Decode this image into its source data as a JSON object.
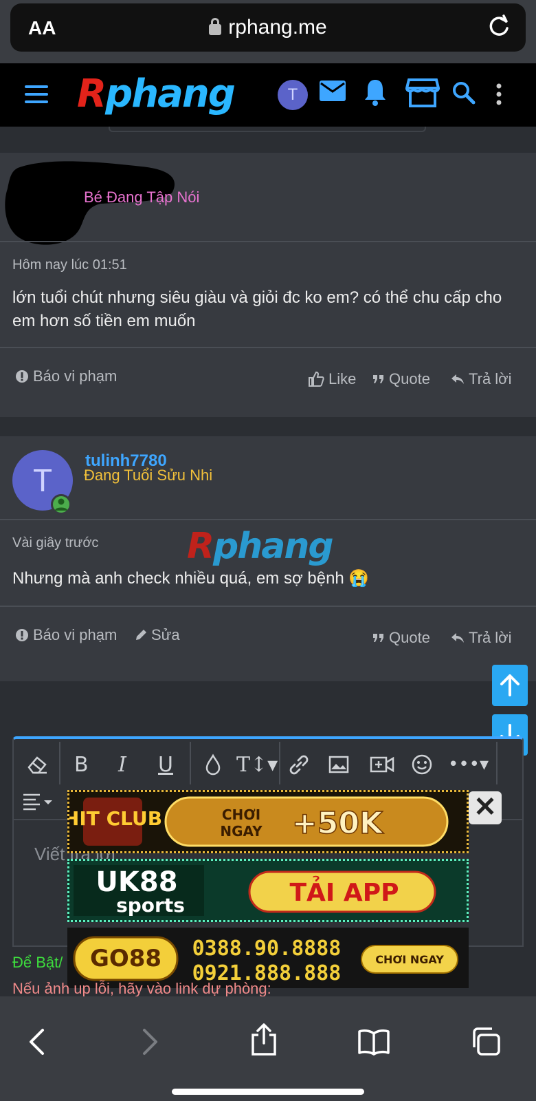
{
  "browser": {
    "text_size_label": "AA",
    "url": "rphang.me"
  },
  "site": {
    "logo_first": "R",
    "logo_rest": "phang",
    "avatar_letter": "T"
  },
  "post1": {
    "user_title": "Bé Đang Tập Nói",
    "timestamp": "Hôm nay lúc 01:51",
    "text": "lớn tuổi chút nhưng siêu giàu và giỏi đc ko em? có thể chu cấp cho em hơn số tiền em muốn",
    "actions": {
      "report": "Báo vi phạm",
      "like": "Like",
      "quote": "Quote",
      "reply": "Trả lời"
    }
  },
  "post2": {
    "avatar_letter": "T",
    "username": "tulinh7780",
    "user_title": "Đang Tuổi Sửu Nhi",
    "timestamp": "Vài giây trước",
    "text": "Nhưng mà anh check nhiều quá, em sợ bệnh 😭",
    "actions": {
      "report": "Báo vi phạm",
      "edit": "Sửa",
      "quote": "Quote",
      "reply": "Trả lời"
    }
  },
  "watermark": {
    "first": "R",
    "rest": "phang"
  },
  "editor": {
    "placeholder": "Viết trả lời"
  },
  "ads": {
    "ad1": {
      "brand": "HIT CLUB",
      "line1": "CHƠI",
      "line2": "NGAY",
      "bonus": "+50K"
    },
    "ad2": {
      "brand1": "UK88",
      "brand2": "sports",
      "cta": "TẢI APP"
    },
    "ad3": {
      "brand": "GO88",
      "phone1": "0388.90.8888",
      "phone2": "0921.888.888",
      "cta": "CHƠI NGAY"
    },
    "close": "✕"
  },
  "footer": {
    "green_text": "Để Bật/",
    "pink_text": "Nếu ảnh up lỗi, hãy vào link dự phòng:"
  },
  "colors": {
    "accent": "#3ea6ff",
    "background": "#2b2e33",
    "post_bg": "#373a40",
    "user_title_post1": "#e873d0",
    "user_title_post2": "#f3c13a"
  }
}
